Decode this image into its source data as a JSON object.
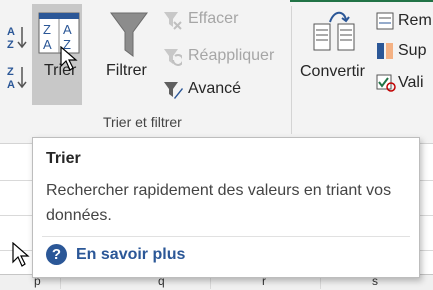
{
  "ribbon": {
    "sort_button": {
      "label": "Trier",
      "icon": "sort-dialog-icon"
    },
    "filter_button": {
      "label": "Filtrer",
      "icon": "funnel-icon"
    },
    "clear_button": {
      "label": "Effacer",
      "icon": "clear-filter-icon",
      "disabled": true
    },
    "reapply_button": {
      "label": "Réappliquer",
      "icon": "reapply-filter-icon",
      "disabled": true
    },
    "advanced_button": {
      "label": "Avancé",
      "icon": "advanced-filter-icon"
    },
    "group_label": "Trier et filtrer",
    "convert_button": {
      "label": "Convertir",
      "icon": "text-to-columns-icon"
    },
    "right_items": [
      {
        "label": "Rem",
        "icon": "flash-fill-icon"
      },
      {
        "label": "Sup",
        "icon": "remove-duplicates-icon"
      },
      {
        "label": "Vali",
        "icon": "data-validation-icon"
      }
    ],
    "sort_az_icon": "sort-a-to-z-icon",
    "sort_za_icon": "sort-z-to-a-icon"
  },
  "sheet": {
    "column_headers": [
      "p",
      "q",
      "r",
      "s"
    ]
  },
  "tooltip": {
    "title": "Trier",
    "description": "Rechercher rapidement des valeurs en triant vos données.",
    "help_link": "En savoir plus",
    "help_icon": "help-circle-icon"
  },
  "colors": {
    "accent": "#217346",
    "link": "#2b5797",
    "pressed_bg": "#c8c8c8"
  }
}
